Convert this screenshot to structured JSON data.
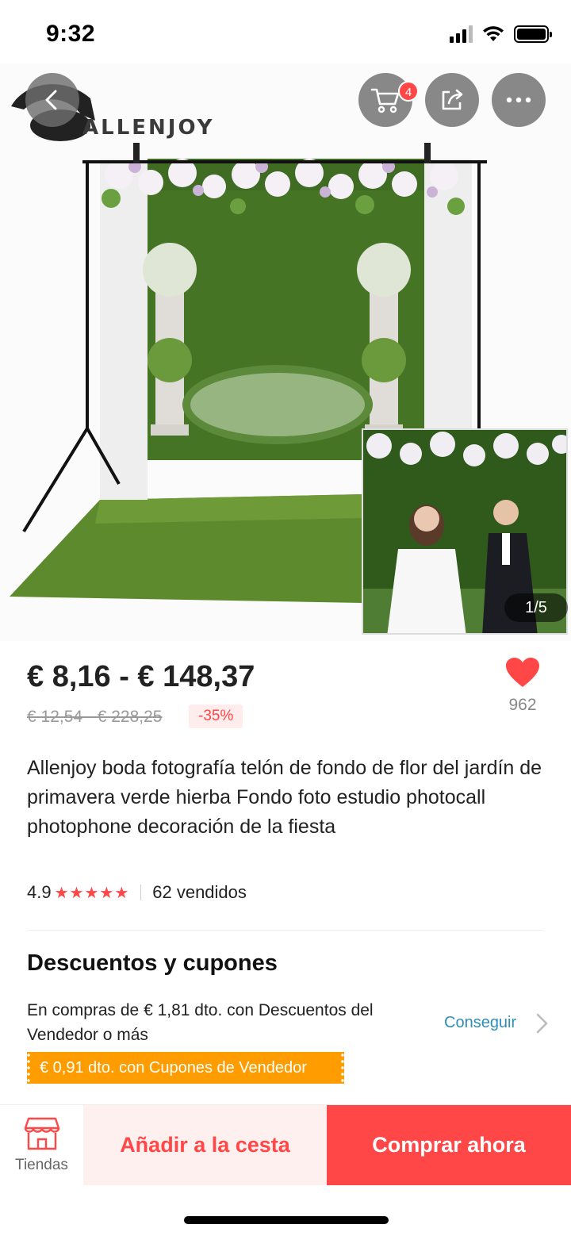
{
  "status_bar": {
    "time": "9:32"
  },
  "header": {
    "brand": "ALLENJOY",
    "cart_count": "4",
    "icons": [
      "back-icon",
      "cart-icon",
      "share-icon",
      "more-icon"
    ]
  },
  "gallery": {
    "counter": "1/5"
  },
  "price": {
    "current": "€ 8,16 - € 148,37",
    "original": "€ 12,54 - € 228,25",
    "discount": "-35%"
  },
  "wishlist": {
    "count": "962"
  },
  "product": {
    "title": "Allenjoy boda fotografía telón de fondo de flor del jardín de primavera verde hierba Fondo foto estudio photocall photophone decoración de la fiesta",
    "rating": "4.9",
    "stars": "★★★★★",
    "sold": "62 vendidos"
  },
  "coupons": {
    "title": "Descuentos y cupones",
    "description": "En compras de € 1,81 dto. con Descuentos del Vendedor o más",
    "link_label": "Conseguir",
    "tag": "€ 0,91 dto. con Cupones de Vendedor"
  },
  "bottom_bar": {
    "stores_label": "Tiendas",
    "add_to_cart": "Añadir a la cesta",
    "buy_now": "Comprar ahora"
  },
  "colors": {
    "accent": "#ff4747",
    "link": "#2e8fb8",
    "coupon": "#ff9c00"
  }
}
